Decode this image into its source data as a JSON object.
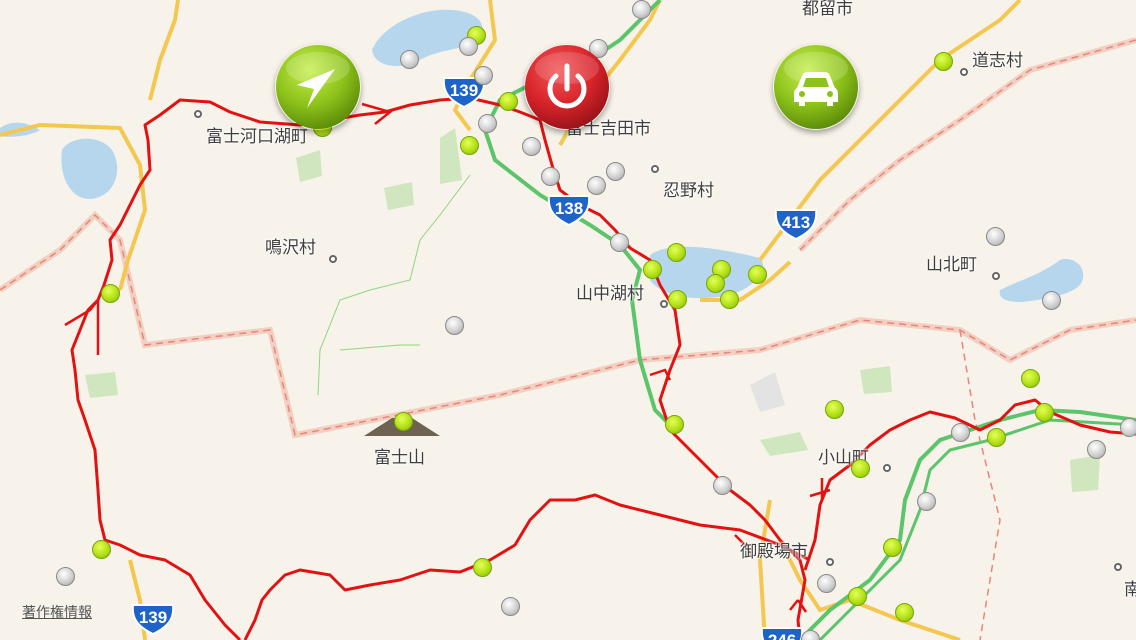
{
  "map": {
    "places": [
      {
        "id": "tsuru",
        "label": "都留市"
      },
      {
        "id": "doshi",
        "label": "道志村"
      },
      {
        "id": "fujikawaguchiko",
        "label": "富士河口湖町"
      },
      {
        "id": "fujiyoshida",
        "label": "富士吉田市"
      },
      {
        "id": "oshino",
        "label": "忍野村"
      },
      {
        "id": "narusawa",
        "label": "鳴沢村"
      },
      {
        "id": "yamanakako",
        "label": "山中湖村"
      },
      {
        "id": "yamakita",
        "label": "山北町"
      },
      {
        "id": "fujisan",
        "label": "富士山"
      },
      {
        "id": "oyama",
        "label": "小山町"
      },
      {
        "id": "gotemba",
        "label": "御殿場市"
      },
      {
        "id": "minami",
        "label": "南"
      }
    ],
    "route_shields": [
      {
        "id": "r139-north",
        "number": "139"
      },
      {
        "id": "r138",
        "number": "138"
      },
      {
        "id": "r413",
        "number": "413"
      },
      {
        "id": "r139-south",
        "number": "139"
      },
      {
        "id": "r246",
        "number": "246"
      }
    ],
    "copyright_label": "著作権情報"
  },
  "controls": {
    "locate_icon": "location-arrow-icon",
    "power_icon": "power-icon",
    "car_icon": "car-icon",
    "colors": {
      "green": "#8cc21a",
      "red": "#d8232a",
      "track": "#e31212",
      "expressway": "#5cc46a",
      "highway": "#f5c542"
    }
  }
}
